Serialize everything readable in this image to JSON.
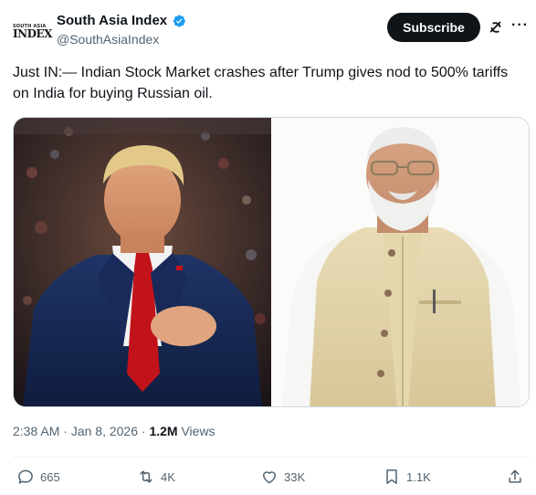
{
  "account": {
    "avatar_line1": "SOUTH ASIA",
    "avatar_line2": "INDEX",
    "name": "South Asia Index",
    "handle": "@SouthAsiaIndex"
  },
  "header": {
    "subscribe_label": "Subscribe"
  },
  "tweet": {
    "text": "Just IN:— Indian Stock Market crashes after Trump gives nod to  500% tariffs on India for buying Russian oil."
  },
  "meta": {
    "time": "2:38 AM",
    "separator": " · ",
    "date": "Jan 8, 2026",
    "views_count": "1.2M",
    "views_label": "Views"
  },
  "actions": {
    "replies": "665",
    "reposts": "4K",
    "likes": "33K",
    "bookmarks": "1.1K"
  },
  "colors": {
    "accent": "#1d9bf0",
    "text_primary": "#0f1419",
    "text_secondary": "#536471",
    "button_bg": "#0f1419"
  },
  "icons": [
    "verified-icon",
    "grok-icon",
    "more-icon",
    "reply-icon",
    "repost-icon",
    "like-icon",
    "bookmark-icon",
    "share-icon"
  ]
}
